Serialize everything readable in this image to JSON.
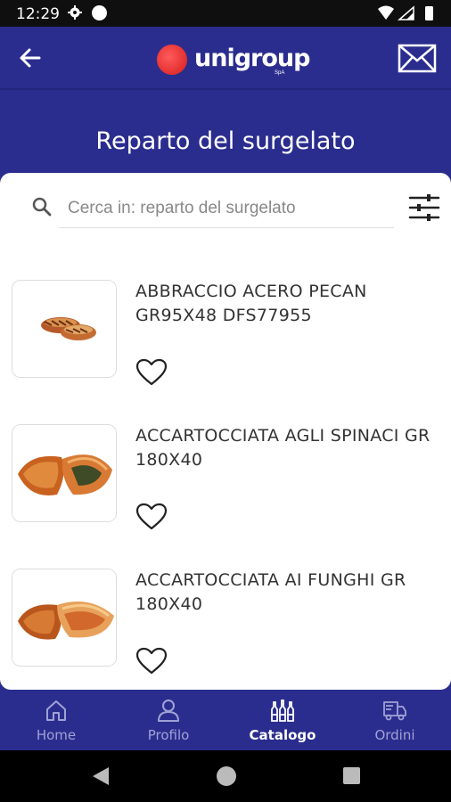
{
  "status": {
    "time": "12:29"
  },
  "header": {
    "logo_text": "unigroup",
    "logo_sub": "SpA"
  },
  "page": {
    "title": "Reparto del surgelato"
  },
  "search": {
    "placeholder": "Cerca in: reparto del surgelato"
  },
  "products": [
    {
      "name": "ABBRACCIO ACERO PECAN GR95X48 DFS77955"
    },
    {
      "name": "ACCARTOCCIATA AGLI SPINACI GR 180X40"
    },
    {
      "name": "ACCARTOCCIATA AI FUNGHI GR 180X40"
    }
  ],
  "nav": {
    "items": [
      {
        "label": "Home",
        "icon": "home-icon"
      },
      {
        "label": "Profilo",
        "icon": "user-icon"
      },
      {
        "label": "Catalogo",
        "icon": "bottles-icon",
        "active": true
      },
      {
        "label": "Ordini",
        "icon": "truck-icon"
      }
    ]
  },
  "colors": {
    "primary": "#2B2D8E",
    "logo_red": "#E02424",
    "nav_inactive": "#9FA2D6"
  }
}
